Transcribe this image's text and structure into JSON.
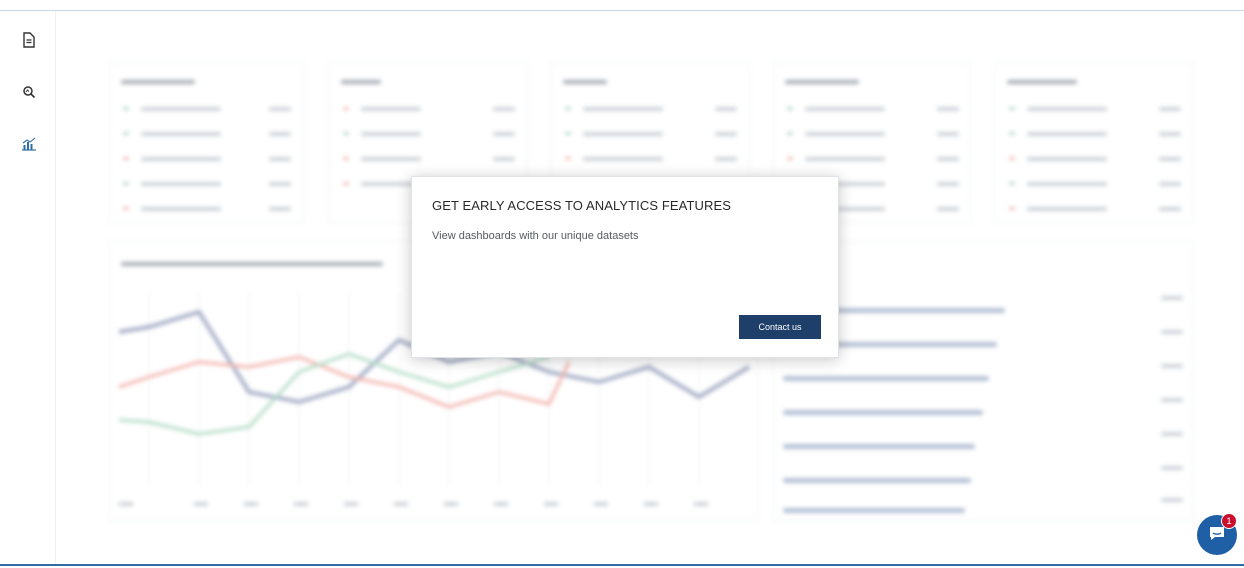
{
  "sidebar": {
    "items": [
      {
        "name": "document-icon",
        "active": false
      },
      {
        "name": "search-analytics-icon",
        "active": false
      },
      {
        "name": "chart-icon",
        "active": true
      }
    ]
  },
  "modal": {
    "title": "GET EARLY ACCESS TO ANALYTICS FEATURES",
    "subtitle": "View dashboards with our unique datasets",
    "cta_label": "Contact us"
  },
  "chat": {
    "icon": "chat-bubble-icon",
    "badge_count": "1"
  },
  "colors": {
    "accent": "#1f3f6b",
    "chat": "#1e5fa6",
    "badge": "#c8102e",
    "sidebar_active": "#2d6da3"
  }
}
